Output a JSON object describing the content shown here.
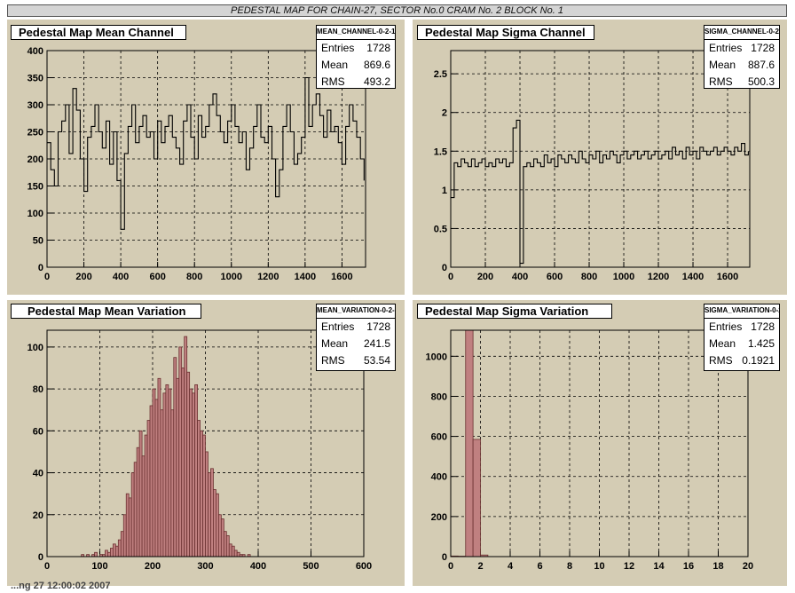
{
  "banner": "PEDESTAL MAP FOR CHAIN-27, SECTOR No.0 CRAM No. 2 BLOCK No. 1",
  "footer": "...ng 27 12:00:02 2007",
  "colors": {
    "pad_bg": "#d4ccb4",
    "hist_fill": "#c08080",
    "line": "#000000"
  },
  "pads": [
    {
      "title": "Pedestal Map Mean Channel",
      "stats": {
        "name": "MEAN_CHANNEL-0-2-1",
        "entries_label": "Entries",
        "entries": "1728",
        "mean_label": "Mean",
        "mean": "869.6",
        "rms_label": "RMS",
        "rms": "493.2"
      }
    },
    {
      "title": "Pedestal Map Sigma Channel",
      "stats": {
        "name": "SIGMA_CHANNEL-0-2-1",
        "entries_label": "Entries",
        "entries": "1728",
        "mean_label": "Mean",
        "mean": "887.6",
        "rms_label": "RMS",
        "rms": "500.3"
      }
    },
    {
      "title": "Pedestal Map Mean Variation",
      "stats": {
        "name": "MEAN_VARIATION-0-2-1",
        "entries_label": "Entries",
        "entries": "1728",
        "mean_label": "Mean",
        "mean": "241.5",
        "rms_label": "RMS",
        "rms": "53.54"
      }
    },
    {
      "title": "Pedestal Map Sigma Variation",
      "stats": {
        "name": "SIGMA_VARIATION-0-2-1",
        "entries_label": "Entries",
        "entries": "1728",
        "mean_label": "Mean",
        "mean": "1.425",
        "rms_label": "RMS",
        "rms": "0.1921"
      }
    }
  ],
  "chart_data": [
    {
      "type": "line",
      "title": "Pedestal Map Mean Channel",
      "xlim": [
        0,
        1728
      ],
      "ylim": [
        0,
        400
      ],
      "xticks": [
        0,
        200,
        400,
        600,
        800,
        1000,
        1200,
        1400,
        1600
      ],
      "yticks": [
        0,
        50,
        100,
        150,
        200,
        250,
        300,
        350,
        400
      ],
      "grid": true,
      "series": [
        {
          "x": [
            0,
            20,
            40,
            60,
            80,
            100,
            120,
            140,
            160,
            180,
            200,
            220,
            240,
            260,
            280,
            300,
            320,
            340,
            360,
            380,
            400,
            420,
            440,
            460,
            480,
            500,
            520,
            540,
            560,
            580,
            600,
            620,
            640,
            660,
            680,
            700,
            720,
            740,
            760,
            780,
            800,
            820,
            840,
            860,
            880,
            900,
            920,
            940,
            960,
            980,
            1000,
            1020,
            1040,
            1060,
            1080,
            1100,
            1120,
            1140,
            1160,
            1180,
            1200,
            1220,
            1240,
            1260,
            1280,
            1300,
            1320,
            1340,
            1360,
            1380,
            1400,
            1420,
            1440,
            1460,
            1480,
            1500,
            1520,
            1540,
            1560,
            1580,
            1600,
            1620,
            1640,
            1660,
            1680,
            1700,
            1720
          ],
          "y": [
            230,
            180,
            150,
            250,
            270,
            300,
            210,
            330,
            290,
            200,
            140,
            240,
            260,
            300,
            250,
            220,
            270,
            190,
            250,
            160,
            70,
            210,
            260,
            300,
            230,
            260,
            280,
            240,
            250,
            200,
            270,
            230,
            260,
            280,
            240,
            220,
            190,
            270,
            300,
            240,
            200,
            280,
            240,
            260,
            300,
            320,
            280,
            250,
            230,
            270,
            300,
            260,
            230,
            250,
            180,
            220,
            260,
            300,
            240,
            230,
            260,
            200,
            130,
            180,
            260,
            300,
            250,
            190,
            210,
            240,
            350,
            260,
            300,
            320,
            280,
            240,
            290,
            250,
            260,
            230,
            190,
            260,
            300,
            270,
            240,
            200,
            160
          ]
        }
      ]
    },
    {
      "type": "line",
      "title": "Pedestal Map Sigma Channel",
      "xlim": [
        0,
        1728
      ],
      "ylim": [
        0,
        2.8
      ],
      "xticks": [
        0,
        200,
        400,
        600,
        800,
        1000,
        1200,
        1400,
        1600
      ],
      "yticks": [
        0,
        0.5,
        1,
        1.5,
        2,
        2.5
      ],
      "grid": true,
      "series": [
        {
          "x": [
            0,
            20,
            40,
            60,
            80,
            100,
            120,
            140,
            160,
            180,
            200,
            220,
            240,
            260,
            280,
            300,
            320,
            340,
            360,
            380,
            400,
            420,
            440,
            460,
            480,
            500,
            520,
            540,
            560,
            580,
            600,
            620,
            640,
            660,
            680,
            700,
            720,
            740,
            760,
            780,
            800,
            820,
            840,
            860,
            880,
            900,
            920,
            940,
            960,
            980,
            1000,
            1020,
            1040,
            1060,
            1080,
            1100,
            1120,
            1140,
            1160,
            1180,
            1200,
            1220,
            1240,
            1260,
            1280,
            1300,
            1320,
            1340,
            1360,
            1380,
            1400,
            1420,
            1440,
            1460,
            1480,
            1500,
            1520,
            1540,
            1560,
            1580,
            1600,
            1620,
            1640,
            1660,
            1680,
            1700,
            1720
          ],
          "y": [
            0.9,
            1.35,
            1.3,
            1.4,
            1.35,
            1.3,
            1.4,
            1.3,
            1.35,
            1.4,
            1.3,
            1.35,
            1.3,
            1.4,
            1.35,
            1.4,
            1.3,
            1.35,
            1.8,
            1.9,
            0.05,
            1.3,
            1.35,
            1.3,
            1.4,
            1.35,
            1.3,
            1.45,
            1.35,
            1.4,
            1.3,
            1.45,
            1.4,
            1.35,
            1.45,
            1.4,
            1.35,
            1.5,
            1.4,
            1.35,
            1.45,
            1.4,
            1.5,
            1.35,
            1.45,
            1.4,
            1.5,
            1.45,
            1.35,
            1.45,
            1.5,
            1.4,
            1.45,
            1.5,
            1.4,
            1.45,
            1.5,
            1.4,
            1.45,
            1.5,
            1.4,
            1.45,
            1.5,
            1.4,
            1.55,
            1.45,
            1.5,
            1.4,
            1.55,
            1.45,
            1.5,
            1.4,
            1.55,
            1.5,
            1.45,
            1.5,
            1.55,
            1.45,
            1.5,
            1.55,
            1.5,
            1.45,
            1.55,
            1.5,
            1.6,
            1.45,
            1.5
          ]
        }
      ]
    },
    {
      "type": "bar",
      "title": "Pedestal Map Mean Variation",
      "xlim": [
        0,
        600
      ],
      "ylim": [
        0,
        108
      ],
      "xticks": [
        0,
        100,
        200,
        300,
        400,
        500,
        600
      ],
      "yticks": [
        0,
        20,
        40,
        60,
        80,
        100
      ],
      "grid": true,
      "bin_width": 5,
      "bins": [
        60,
        65,
        70,
        75,
        80,
        85,
        90,
        95,
        100,
        105,
        110,
        115,
        120,
        125,
        130,
        135,
        140,
        145,
        150,
        155,
        160,
        165,
        170,
        175,
        180,
        185,
        190,
        195,
        200,
        205,
        210,
        215,
        220,
        225,
        230,
        235,
        240,
        245,
        250,
        255,
        260,
        265,
        270,
        275,
        280,
        285,
        290,
        295,
        300,
        305,
        310,
        315,
        320,
        325,
        330,
        335,
        340,
        345,
        350,
        355,
        360,
        365,
        370,
        375,
        380
      ],
      "values": [
        0,
        1,
        0,
        1,
        0,
        1,
        2,
        0,
        1,
        1,
        3,
        2,
        4,
        6,
        5,
        8,
        12,
        20,
        30,
        28,
        40,
        45,
        52,
        60,
        48,
        58,
        65,
        72,
        80,
        75,
        85,
        70,
        78,
        82,
        80,
        70,
        95,
        85,
        100,
        90,
        105,
        88,
        80,
        78,
        82,
        65,
        60,
        58,
        50,
        40,
        42,
        32,
        30,
        20,
        18,
        12,
        10,
        6,
        5,
        3,
        2,
        1,
        1,
        0,
        1
      ]
    },
    {
      "type": "bar",
      "title": "Pedestal Map Sigma Variation",
      "xlim": [
        0,
        20
      ],
      "ylim": [
        0,
        1130
      ],
      "xticks": [
        0,
        2,
        4,
        6,
        8,
        10,
        12,
        14,
        16,
        18,
        20
      ],
      "yticks": [
        0,
        200,
        400,
        600,
        800,
        1000
      ],
      "grid": true,
      "bin_width": 0.5,
      "bins": [
        0,
        0.5,
        1,
        1.5,
        2,
        2.5
      ],
      "values": [
        3,
        2,
        1130,
        585,
        8,
        0
      ]
    }
  ]
}
